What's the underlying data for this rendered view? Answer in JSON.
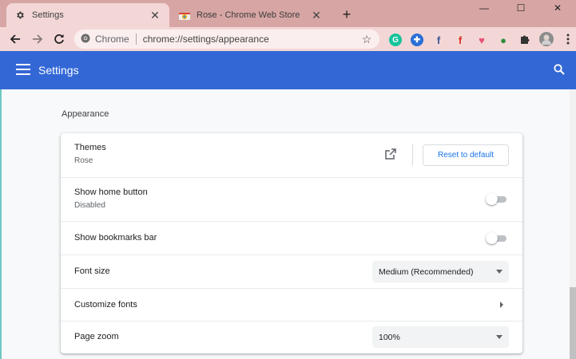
{
  "tabs": [
    {
      "title": "Settings",
      "active": true
    },
    {
      "title": "Rose - Chrome Web Store",
      "active": false
    }
  ],
  "window_controls": {
    "minimize": "—",
    "maximize": "☐",
    "close": "✕"
  },
  "omnibox": {
    "chip": "Chrome",
    "url": "chrome://settings/appearance"
  },
  "extensions": [
    {
      "icon": "grammarly-icon",
      "glyph": "G",
      "color": "#15c39a"
    },
    {
      "icon": "extension-blue-icon",
      "glyph": "✚",
      "color": "#2a6fd6"
    },
    {
      "icon": "facebook-icon",
      "glyph": "f",
      "color": "#3b5998"
    },
    {
      "icon": "facebook-red-icon",
      "glyph": "f",
      "color": "#d93025"
    },
    {
      "icon": "heart-icon",
      "glyph": "♥",
      "color": "#e94e77"
    },
    {
      "icon": "globe-icon",
      "glyph": "●",
      "color": "#2e8b3a"
    }
  ],
  "header": {
    "title": "Settings"
  },
  "section": {
    "title": "Appearance"
  },
  "rows": {
    "themes": {
      "label": "Themes",
      "value": "Rose",
      "button": "Reset to default"
    },
    "home_button": {
      "label": "Show home button",
      "value": "Disabled",
      "enabled": false
    },
    "bookmarks_bar": {
      "label": "Show bookmarks bar",
      "enabled": false
    },
    "font_size": {
      "label": "Font size",
      "value": "Medium (Recommended)"
    },
    "customize_fonts": {
      "label": "Customize fonts"
    },
    "page_zoom": {
      "label": "Page zoom",
      "value": "100%"
    }
  }
}
